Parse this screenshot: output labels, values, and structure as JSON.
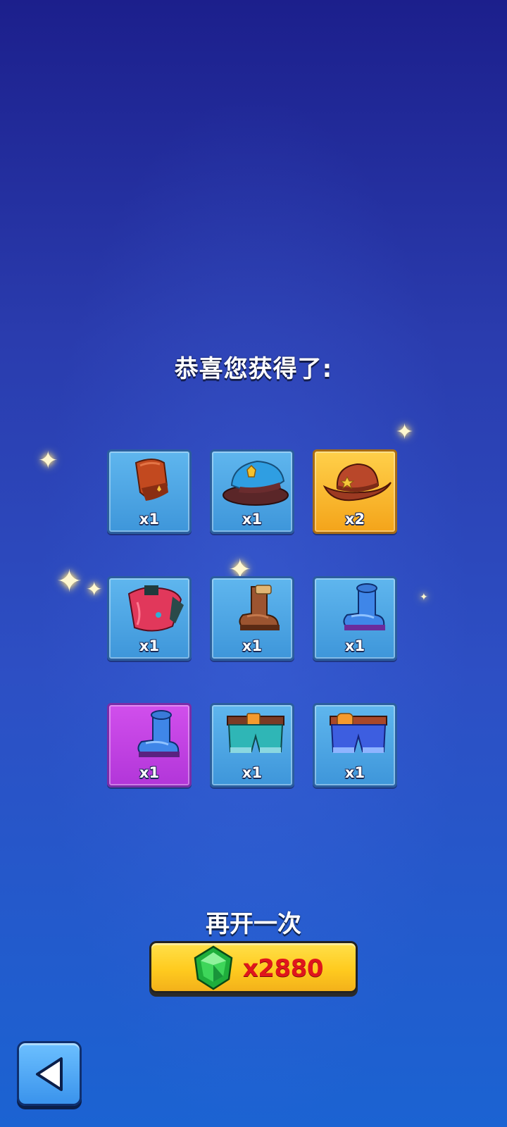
{
  "header": {
    "title": "恭喜您获得了:"
  },
  "rewards": [
    {
      "name": "red-armguard-icon",
      "qty": "x1",
      "rarity": "blue"
    },
    {
      "name": "police-cap-icon",
      "qty": "x1",
      "rarity": "blue"
    },
    {
      "name": "cowboy-hat-icon",
      "qty": "x2",
      "rarity": "gold"
    },
    {
      "name": "red-jacket-icon",
      "qty": "x1",
      "rarity": "blue"
    },
    {
      "name": "brown-boot-icon",
      "qty": "x1",
      "rarity": "blue"
    },
    {
      "name": "blue-boot-icon",
      "qty": "x1",
      "rarity": "blue"
    },
    {
      "name": "blue-boot-purple-icon",
      "qty": "x1",
      "rarity": "purple"
    },
    {
      "name": "teal-shorts-icon",
      "qty": "x1",
      "rarity": "blue"
    },
    {
      "name": "blue-shorts-icon",
      "qty": "x1",
      "rarity": "blue"
    }
  ],
  "again": {
    "label": "再开一次",
    "price": "x2880",
    "currency_icon": "green-gem-icon"
  },
  "back": {
    "icon": "back-arrow-icon"
  },
  "colors": {
    "gold": "#ffcb1f",
    "price_red": "#e0161c",
    "tile_blue": "#4aa2e2",
    "tile_purple": "#c540e2",
    "tile_gold": "#f8b52a"
  }
}
